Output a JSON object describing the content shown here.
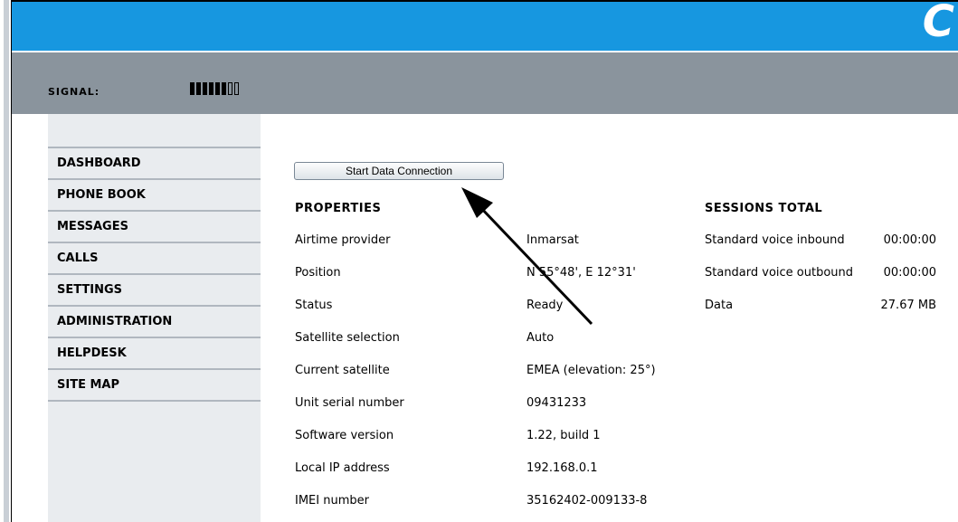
{
  "header": {
    "logo_text": "C"
  },
  "signal": {
    "label": "SIGNAL:",
    "bars_on": 6,
    "bars_total": 8
  },
  "sidebar": {
    "items": [
      {
        "label": "DASHBOARD"
      },
      {
        "label": "PHONE BOOK"
      },
      {
        "label": "MESSAGES"
      },
      {
        "label": "CALLS"
      },
      {
        "label": "SETTINGS"
      },
      {
        "label": "ADMINISTRATION"
      },
      {
        "label": "HELPDESK"
      },
      {
        "label": "SITE MAP"
      }
    ]
  },
  "main": {
    "start_button": "Start Data Connection",
    "properties": {
      "title": "PROPERTIES",
      "rows": [
        {
          "label": "Airtime provider",
          "value": "Inmarsat"
        },
        {
          "label": "Position",
          "value": "N 55°48', E 12°31'"
        },
        {
          "label": "Status",
          "value": "Ready"
        },
        {
          "label": "Satellite selection",
          "value": "Auto"
        },
        {
          "label": "Current satellite",
          "value": "EMEA (elevation: 25°)"
        },
        {
          "label": "Unit serial number",
          "value": "09431233"
        },
        {
          "label": "Software version",
          "value": "1.22, build 1"
        },
        {
          "label": "Local IP address",
          "value": "192.168.0.1"
        },
        {
          "label": "IMEI number",
          "value": "35162402-009133-8"
        }
      ]
    },
    "sessions": {
      "title": "SESSIONS TOTAL",
      "rows": [
        {
          "label": "Standard voice inbound",
          "value": "00:00:00"
        },
        {
          "label": "Standard voice outbound",
          "value": "00:00:00"
        },
        {
          "label": "Data",
          "value": "27.67 MB"
        }
      ]
    }
  },
  "colors": {
    "banner": "#1797e0",
    "signal_bar": "#8a949d",
    "sidebar": "#e9ecef"
  }
}
